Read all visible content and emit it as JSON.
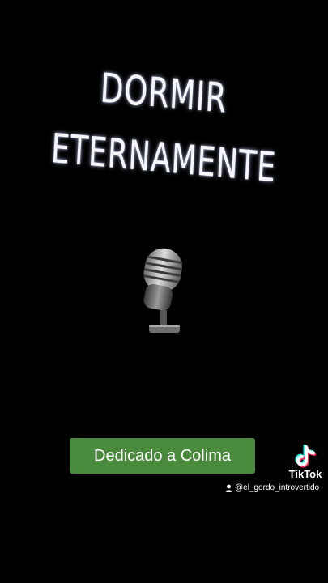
{
  "title": {
    "line1": "DORMIR",
    "line2": "ETERNAMENTE"
  },
  "media_icon": "microphone-icon",
  "caption": {
    "label": "Dedicado a Colima"
  },
  "watermark": {
    "logo_icon": "tiktok-logo-icon",
    "brand": "TikTok",
    "user_icon": "person-icon",
    "handle": "@el_gordo_introvertido"
  },
  "colors": {
    "background": "#000000",
    "caption_bg": "#4a8a3c",
    "tiktok_cyan": "#25f4ee",
    "tiktok_red": "#fe2c55"
  }
}
